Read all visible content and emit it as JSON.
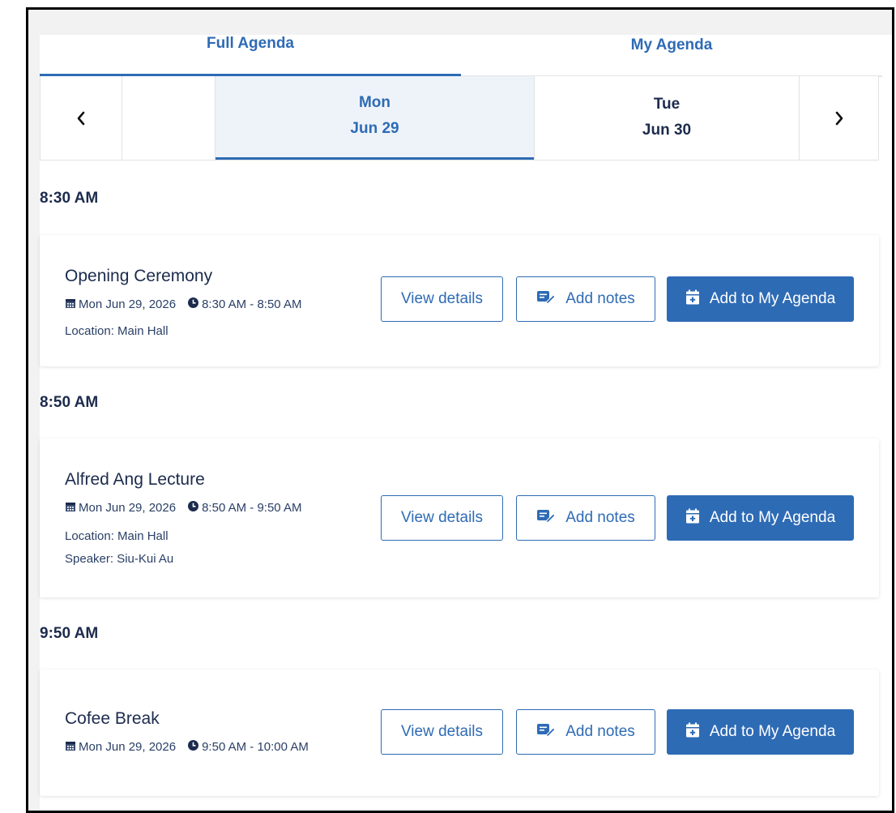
{
  "tabs": {
    "full": "Full Agenda",
    "my": "My Agenda"
  },
  "days": {
    "selected": {
      "name": "Mon",
      "date": "Jun 29"
    },
    "next": {
      "name": "Tue",
      "date": "Jun 30"
    }
  },
  "sessions": [
    {
      "time": "8:30 AM",
      "title": "Opening Ceremony",
      "date": "Mon Jun 29, 2026",
      "range": "8:30 AM - 8:50 AM",
      "location": "Location: Main Hall",
      "speaker": ""
    },
    {
      "time": "8:50 AM",
      "title": "Alfred Ang Lecture",
      "date": "Mon Jun 29, 2026",
      "range": "8:50 AM - 9:50 AM",
      "location": "Location: Main Hall",
      "speaker": "Speaker: Siu-Kui Au"
    },
    {
      "time": "9:50 AM",
      "title": "Cofee Break",
      "date": "Mon Jun 29, 2026",
      "range": "9:50 AM - 10:00 AM",
      "location": "",
      "speaker": ""
    }
  ],
  "buttons": {
    "view": "View details",
    "notes": "Add notes",
    "add": "Add to My Agenda"
  },
  "colors": {
    "accent": "#2e6bb5",
    "text_dark": "#1c2b4d"
  },
  "icons": {
    "prev": "chevron-left-icon",
    "next": "chevron-right-icon",
    "calendar": "calendar-icon",
    "clock": "clock-icon",
    "notes": "notes-edit-icon",
    "add": "calendar-plus-icon"
  }
}
